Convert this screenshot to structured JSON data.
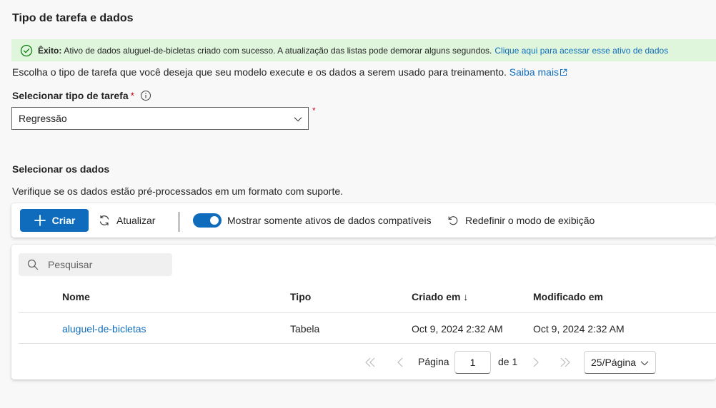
{
  "page": {
    "title": "Tipo de tarefa e dados"
  },
  "message_bar": {
    "label": "Êxito:",
    "text": "Ativo de dados aluguel-de-bicletas criado com sucesso. A atualização das listas pode demorar alguns segundos.",
    "link": "Clique aqui para acessar esse ativo de dados",
    "icon": "checkmark-circle-icon",
    "background": "#dff6dd",
    "icon_color": "#107c10"
  },
  "intro": {
    "text": "Escolha o tipo de tarefa que você deseja que seu modelo execute e os dados a serem usado para treinamento.",
    "link": "Saiba mais"
  },
  "task_type": {
    "label": "Selecionar tipo de tarefa",
    "required_mark": "*",
    "selected": "Regressão"
  },
  "data_section": {
    "title": "Selecionar os dados",
    "description": "Verifique se os dados estão pré-processados em um formato com suporte."
  },
  "toolbar": {
    "create_label": "Criar",
    "refresh_label": "Atualizar",
    "toggle_label": "Mostrar somente ativos de dados compatíveis",
    "toggle_on": true,
    "reset_label": "Redefinir o modo de exibição"
  },
  "grid": {
    "search_placeholder": "Pesquisar",
    "columns": [
      "Nome",
      "Tipo",
      "Criado em",
      "Modificado em"
    ],
    "sort_indicator": "↓",
    "rows": [
      {
        "name": "aluguel-de-bicletas",
        "type": "Tabela",
        "created": "Oct 9, 2024 2:32 AM",
        "modified": "Oct 9, 2024 2:32 AM"
      }
    ]
  },
  "pager": {
    "page_label": "Página",
    "page_value": "1",
    "of_label": "de 1",
    "page_size": "25/Página"
  },
  "colors": {
    "accent": "#0f6cbd",
    "required": "#c50f1f"
  }
}
